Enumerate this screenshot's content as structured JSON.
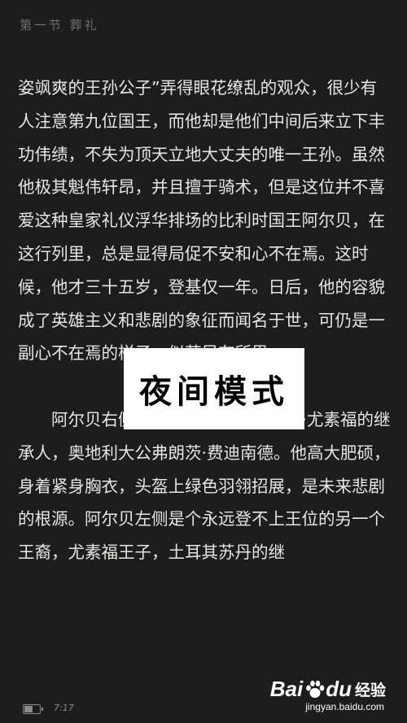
{
  "chapter_title": "第一节 葬礼",
  "paragraphs": [
    "姿飒爽的王孙公子”弄得眼花缭乱的观众，很少有人注意第九位国王，而他却是他们中间后来立下丰功伟绩，不失为顶天立地大丈夫的唯一王孙。虽然他极其魁伟轩昂，并且擅于骑术，但是这位并不喜爱这种皇家礼仪浮华排场的比利时国王阿尔贝，在这行列里，总是显得局促不安和心不在焉。这时候，他才三十五岁，登基仅一年。日后，他的容貌成了英雄主义和悲剧的象征而闻名于世，可仍是一副心不在焉的样子，似若另有所思。",
    "阿尔贝右侧一骑，是老奥皇弗朗茨·尤素福的继承人，奥地利大公弗朗茨·费迪南德。他高大肥硕，身着紧身胸衣，头盔上绿色羽翎招展，是未来悲剧的根源。阿尔贝左侧是个永远登不上王位的另一个王裔，尤素福王子，土耳其苏丹的继"
  ],
  "overlay_label": "夜间模式",
  "status": {
    "time": "7:17",
    "battery_level": 0.55
  },
  "watermark": {
    "brand_left": "Bai",
    "brand_right": "du",
    "brand_cn": "经验",
    "url": "jingyan.baidu.com",
    "icon": "baidu-paw-icon"
  }
}
